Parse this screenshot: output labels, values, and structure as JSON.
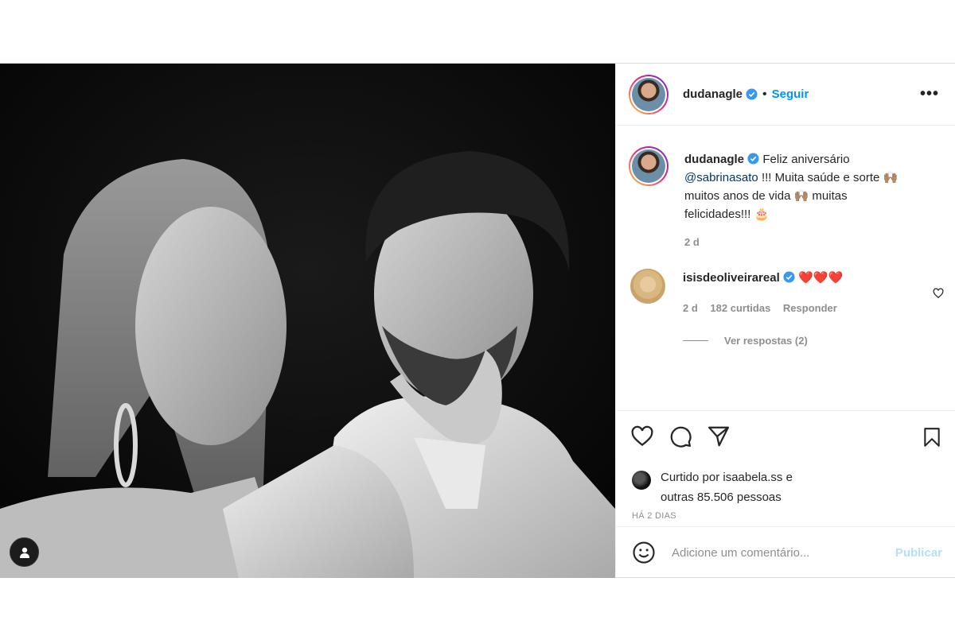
{
  "post": {
    "author": "dudanagle",
    "follow_label": "Seguir",
    "more_label": "•••",
    "caption": {
      "author": "dudanagle",
      "text_1": "Feliz aniversário",
      "mention": "@sabrinasato",
      "text_2": " !!! Muita saúde e sorte 🙌🏽",
      "text_3": "muitos anos de vida 🙌🏽 muitas",
      "text_4": "felicidades!!! 🎂",
      "age": "2 d"
    },
    "comment": {
      "author": "isisdeoliveirareal",
      "text": "❤️❤️❤️",
      "age": "2 d",
      "likes": "182 curtidas",
      "reply_label": "Responder",
      "view_replies": "Ver respostas (2)"
    },
    "likes_line_1_prefix": "Curtido por ",
    "likes_user": "isaabela.ss",
    "likes_line_1_suffix": " e",
    "likes_line_2": "outras 85.506 pessoas",
    "timestamp": "HÁ 2 DIAS",
    "comment_placeholder": "Adicione um comentário...",
    "publish_label": "Publicar"
  },
  "icons": {
    "verified": "verified-badge-icon",
    "heart": "heart-icon",
    "comment": "comment-icon",
    "share": "share-icon",
    "bookmark": "bookmark-icon",
    "emoji": "emoji-icon",
    "tag": "user-tag-icon"
  },
  "colors": {
    "follow": "#0095f6",
    "publish_disabled": "#b2dffc",
    "verified": "#3897f0",
    "heart": "#ed4956"
  }
}
